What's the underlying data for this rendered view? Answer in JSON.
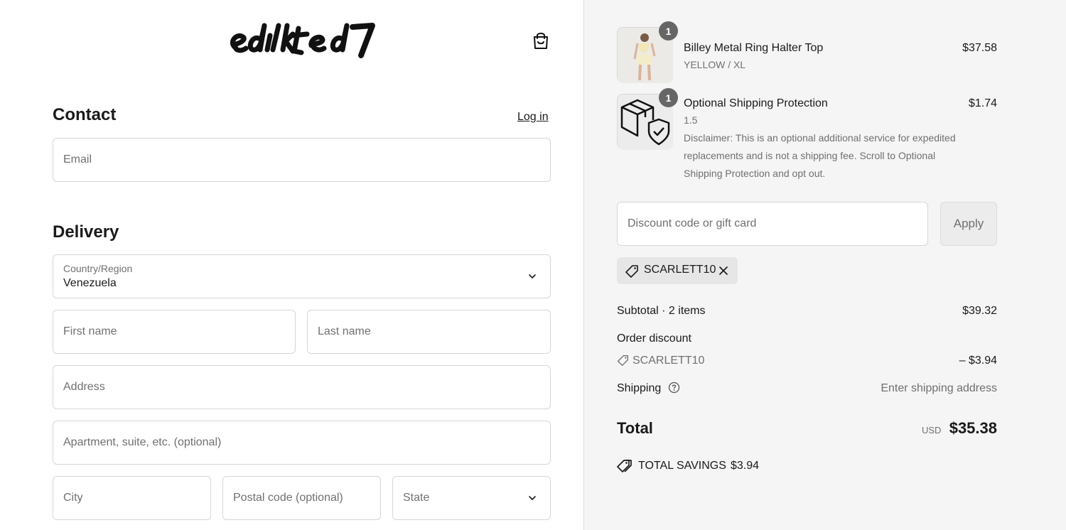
{
  "brand": {
    "logo_text": "edikted"
  },
  "contact": {
    "title": "Contact",
    "login_label": "Log in",
    "email_placeholder": "Email"
  },
  "delivery": {
    "title": "Delivery",
    "country_label": "Country/Region",
    "country_value": "Venezuela",
    "first_name_placeholder": "First name",
    "last_name_placeholder": "Last name",
    "address_placeholder": "Address",
    "apartment_placeholder": "Apartment, suite, etc. (optional)",
    "city_placeholder": "City",
    "postal_placeholder": "Postal code (optional)",
    "state_placeholder": "State"
  },
  "cart": {
    "items": [
      {
        "quantity": "1",
        "name": "Billey Metal Ring Halter Top",
        "variant": "YELLOW / XL",
        "price": "$37.58"
      },
      {
        "quantity": "1",
        "name": "Optional Shipping Protection",
        "variant": "1.5",
        "price": "$1.74",
        "disclaimer": "Disclaimer: This is an optional additional service for expedited replacements and is not a shipping fee. Scroll to Optional Shipping Protection and opt out."
      }
    ],
    "discount_placeholder": "Discount code or gift card",
    "apply_label": "Apply",
    "applied_code": "SCARLETT10"
  },
  "summary": {
    "subtotal_label": "Subtotal · 2 items",
    "subtotal_value": "$39.32",
    "order_discount_label": "Order discount",
    "discount_code": "SCARLETT10",
    "discount_value": "– $3.94",
    "shipping_label": "Shipping",
    "shipping_value": "Enter shipping address",
    "total_label": "Total",
    "currency": "USD",
    "total_value": "$35.38",
    "savings_label": "TOTAL SAVINGS",
    "savings_value": "$3.94"
  },
  "colors": {
    "panel_bg": "#f5f5f5",
    "badge_bg": "#666666",
    "border": "#d6d6d6"
  }
}
